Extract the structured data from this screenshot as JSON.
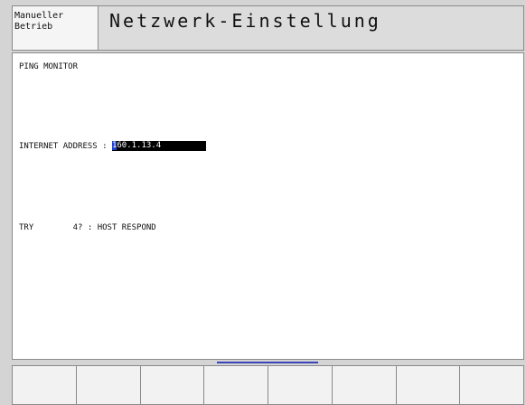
{
  "header": {
    "mode_line1": "Manueller",
    "mode_line2": "Betrieb",
    "title": "Netzwerk-Einstellung"
  },
  "main": {
    "heading": "PING MONITOR",
    "address_label": "INTERNET ADDRESS : ",
    "address_cursor_char": "1",
    "address_value_rest": "60.1.13.4",
    "try_line": "TRY        4? : HOST RESPOND"
  },
  "softkeys": [
    "",
    "",
    "",
    "",
    "",
    "",
    "",
    ""
  ],
  "colors": {
    "background": "#d4d4d4",
    "panel": "#ffffff",
    "field": "#000000",
    "cursor": "#1e3fcf",
    "scroll_indicator": "#3a44b8"
  }
}
